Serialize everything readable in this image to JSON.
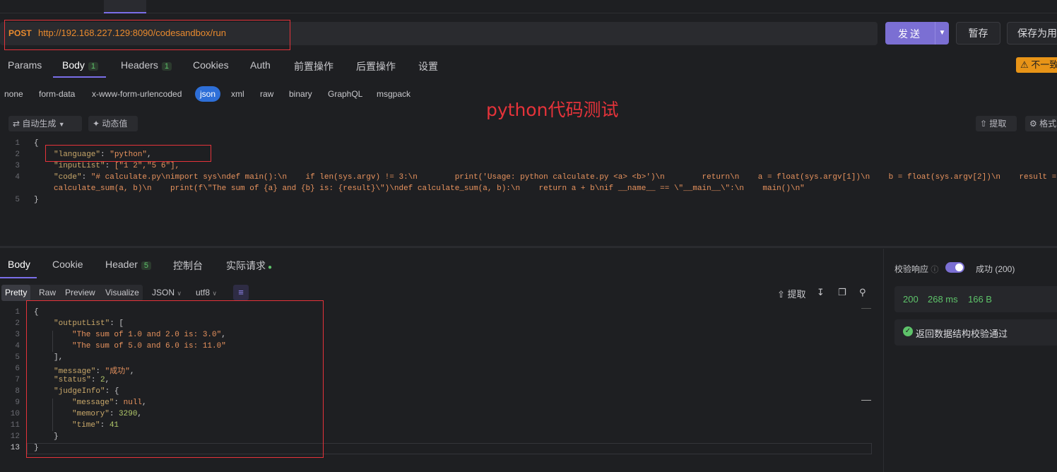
{
  "request": {
    "method": "POST",
    "url": "http://192.168.227.129:8090/codesandbox/run",
    "send_label": "发送",
    "save_label": "暂存",
    "save_as_label": "保存为用",
    "warning_label": "不一致"
  },
  "param_tabs": [
    {
      "label": "Params"
    },
    {
      "label": "Body",
      "badge": "1"
    },
    {
      "label": "Headers",
      "badge": "1"
    },
    {
      "label": "Cookies"
    },
    {
      "label": "Auth"
    },
    {
      "label": "前置操作"
    },
    {
      "label": "后置操作"
    },
    {
      "label": "设置"
    }
  ],
  "body_types": [
    "none",
    "form-data",
    "x-www-form-urlencoded",
    "json",
    "xml",
    "raw",
    "binary",
    "GraphQL",
    "msgpack"
  ],
  "annotation": "python代码测试",
  "toolbar": {
    "auto_generate": "自动生成",
    "dynamic_value": "动态值",
    "extract": "提取",
    "format": "格式"
  },
  "request_body": {
    "line_numbers": [
      "1",
      "2",
      "3",
      "4",
      "",
      "5"
    ],
    "brace_open": "{",
    "brace_close": "}",
    "key_language": "\"language\"",
    "val_language": "\"python\"",
    "key_inputList": "\"inputList\"",
    "val_inputList": "[\"1 2\",\"5 6\"],",
    "key_code": "\"code\"",
    "val_code_1": "\"# calculate.py\\nimport sys\\ndef main():\\n    if len(sys.argv) != 3:\\n        print('Usage: python calculate.py <a> <b>')\\n        return\\n    a = float(sys.argv[1])\\n    b = float(sys.argv[2])\\n    result =",
    "val_code_2": "calculate_sum(a, b)\\n    print(f\\\"The sum of {a} and {b} is: {result}\\\")\\ndef calculate_sum(a, b):\\n    return a + b\\nif __name__ == \\\"__main__\\\":\\n    main()\\n\""
  },
  "response_tabs": [
    {
      "label": "Body"
    },
    {
      "label": "Cookie"
    },
    {
      "label": "Header",
      "badge": "5"
    },
    {
      "label": "控制台"
    },
    {
      "label": "实际请求"
    }
  ],
  "response_formats": [
    "Pretty",
    "Raw",
    "Preview",
    "Visualize"
  ],
  "response_format_select": "JSON",
  "response_encoding_select": "utf8",
  "response_extract_label": "提取",
  "response_body": {
    "line_numbers": [
      "1",
      "2",
      "3",
      "4",
      "5",
      "6",
      "7",
      "8",
      "9",
      "10",
      "11",
      "12",
      "13"
    ],
    "brace_open": "{",
    "key_outputList": "\"outputList\"",
    "bracket_open": "[",
    "out_1": "\"The sum of 1.0 and 2.0 is: 3.0\"",
    "out_2": "\"The sum of 5.0 and 6.0 is: 11.0\"",
    "bracket_close": "],",
    "key_message": "\"message\"",
    "val_message": "\"成功\"",
    "key_status": "\"status\"",
    "val_status": "2",
    "key_judgeInfo": "\"judgeInfo\"",
    "key_jmessage": "\"message\"",
    "val_jmessage": "null",
    "key_memory": "\"memory\"",
    "val_memory": "3290",
    "key_time": "\"time\"",
    "val_time": "41",
    "inner_close": "}",
    "brace_close": "}"
  },
  "validation": {
    "label": "校验响应",
    "enabled": true,
    "result": "成功 (200)",
    "status_code": "200",
    "time": "268 ms",
    "size": "166 B",
    "pass_message": "返回数据结构校验通过"
  },
  "colors": {
    "accent": "#7b6fd3",
    "method": "#e98a2e",
    "success": "#5ec36a",
    "annotation_red": "#e5333a"
  }
}
